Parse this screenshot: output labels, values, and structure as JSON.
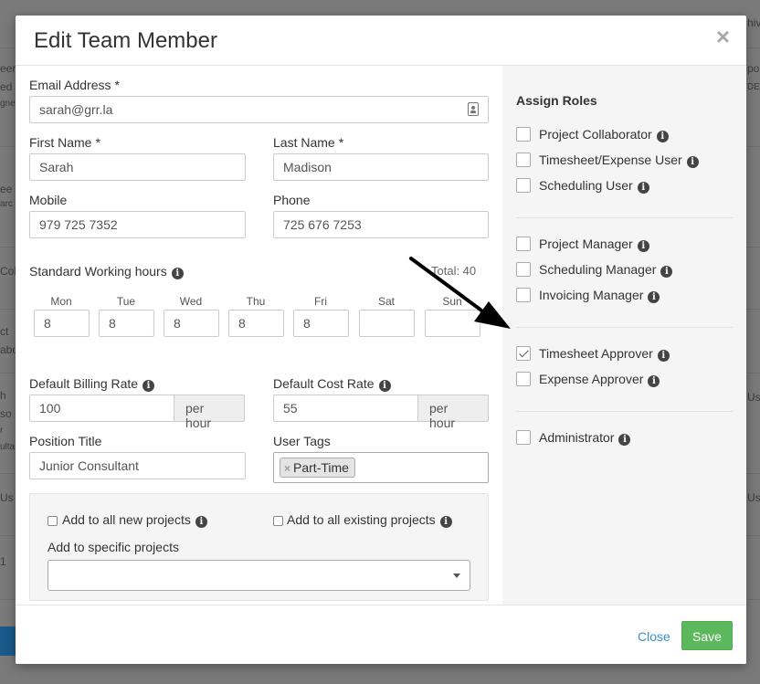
{
  "background": {
    "fragments": [
      "eer",
      "ed",
      "gne",
      "ee",
      "arc",
      "Col",
      "ct",
      "abo",
      "h",
      "so",
      "r",
      "ulta",
      "Us",
      "1",
      "hiv",
      "po",
      "DE",
      "Us",
      "Us"
    ]
  },
  "modal": {
    "title": "Edit Team Member",
    "close_glyph": "×"
  },
  "form": {
    "email": {
      "label": "Email Address",
      "required_mark": "*",
      "value": "sarah@grr.la"
    },
    "first_name": {
      "label": "First Name",
      "required_mark": "*",
      "value": "Sarah"
    },
    "last_name": {
      "label": "Last Name",
      "required_mark": "*",
      "value": "Madison"
    },
    "mobile": {
      "label": "Mobile",
      "value": "979 725 7352"
    },
    "phone": {
      "label": "Phone",
      "value": "725 676 7253"
    },
    "working_hours": {
      "label": "Standard Working hours",
      "total_text": "Total: 40",
      "days": [
        {
          "name": "Mon",
          "value": "8"
        },
        {
          "name": "Tue",
          "value": "8"
        },
        {
          "name": "Wed",
          "value": "8"
        },
        {
          "name": "Thu",
          "value": "8"
        },
        {
          "name": "Fri",
          "value": "8"
        },
        {
          "name": "Sat",
          "value": ""
        },
        {
          "name": "Sun",
          "value": ""
        }
      ]
    },
    "billing_rate": {
      "label": "Default Billing Rate",
      "value": "100",
      "unit": "per hour"
    },
    "cost_rate": {
      "label": "Default Cost Rate",
      "value": "55",
      "unit": "per hour"
    },
    "position_title": {
      "label": "Position Title",
      "value": "Junior Consultant"
    },
    "user_tags": {
      "label": "User Tags",
      "tags": [
        "Part-Time"
      ],
      "remove_glyph": "×"
    },
    "projects": {
      "add_all_new": "Add to all new projects",
      "add_all_existing": "Add to all existing projects",
      "specific_label": "Add to specific projects",
      "specific_value": ""
    }
  },
  "roles": {
    "title": "Assign Roles",
    "groups": [
      [
        {
          "label": "Project Collaborator",
          "checked": false
        },
        {
          "label": "Timesheet/Expense User",
          "checked": false
        },
        {
          "label": "Scheduling User",
          "checked": false
        }
      ],
      [
        {
          "label": "Project Manager",
          "checked": false
        },
        {
          "label": "Scheduling Manager",
          "checked": false
        },
        {
          "label": "Invoicing Manager",
          "checked": false
        }
      ],
      [
        {
          "label": "Timesheet Approver",
          "checked": true
        },
        {
          "label": "Expense Approver",
          "checked": false
        }
      ],
      [
        {
          "label": "Administrator",
          "checked": false
        }
      ]
    ]
  },
  "footer": {
    "close_label": "Close",
    "save_label": "Save"
  },
  "icons": {
    "info": "i",
    "contact_card": "contact-card-icon"
  },
  "colors": {
    "save_button": "#5cb85c",
    "close_link": "#3a8fc9",
    "roles_panel_bg": "#f5f5f5"
  }
}
